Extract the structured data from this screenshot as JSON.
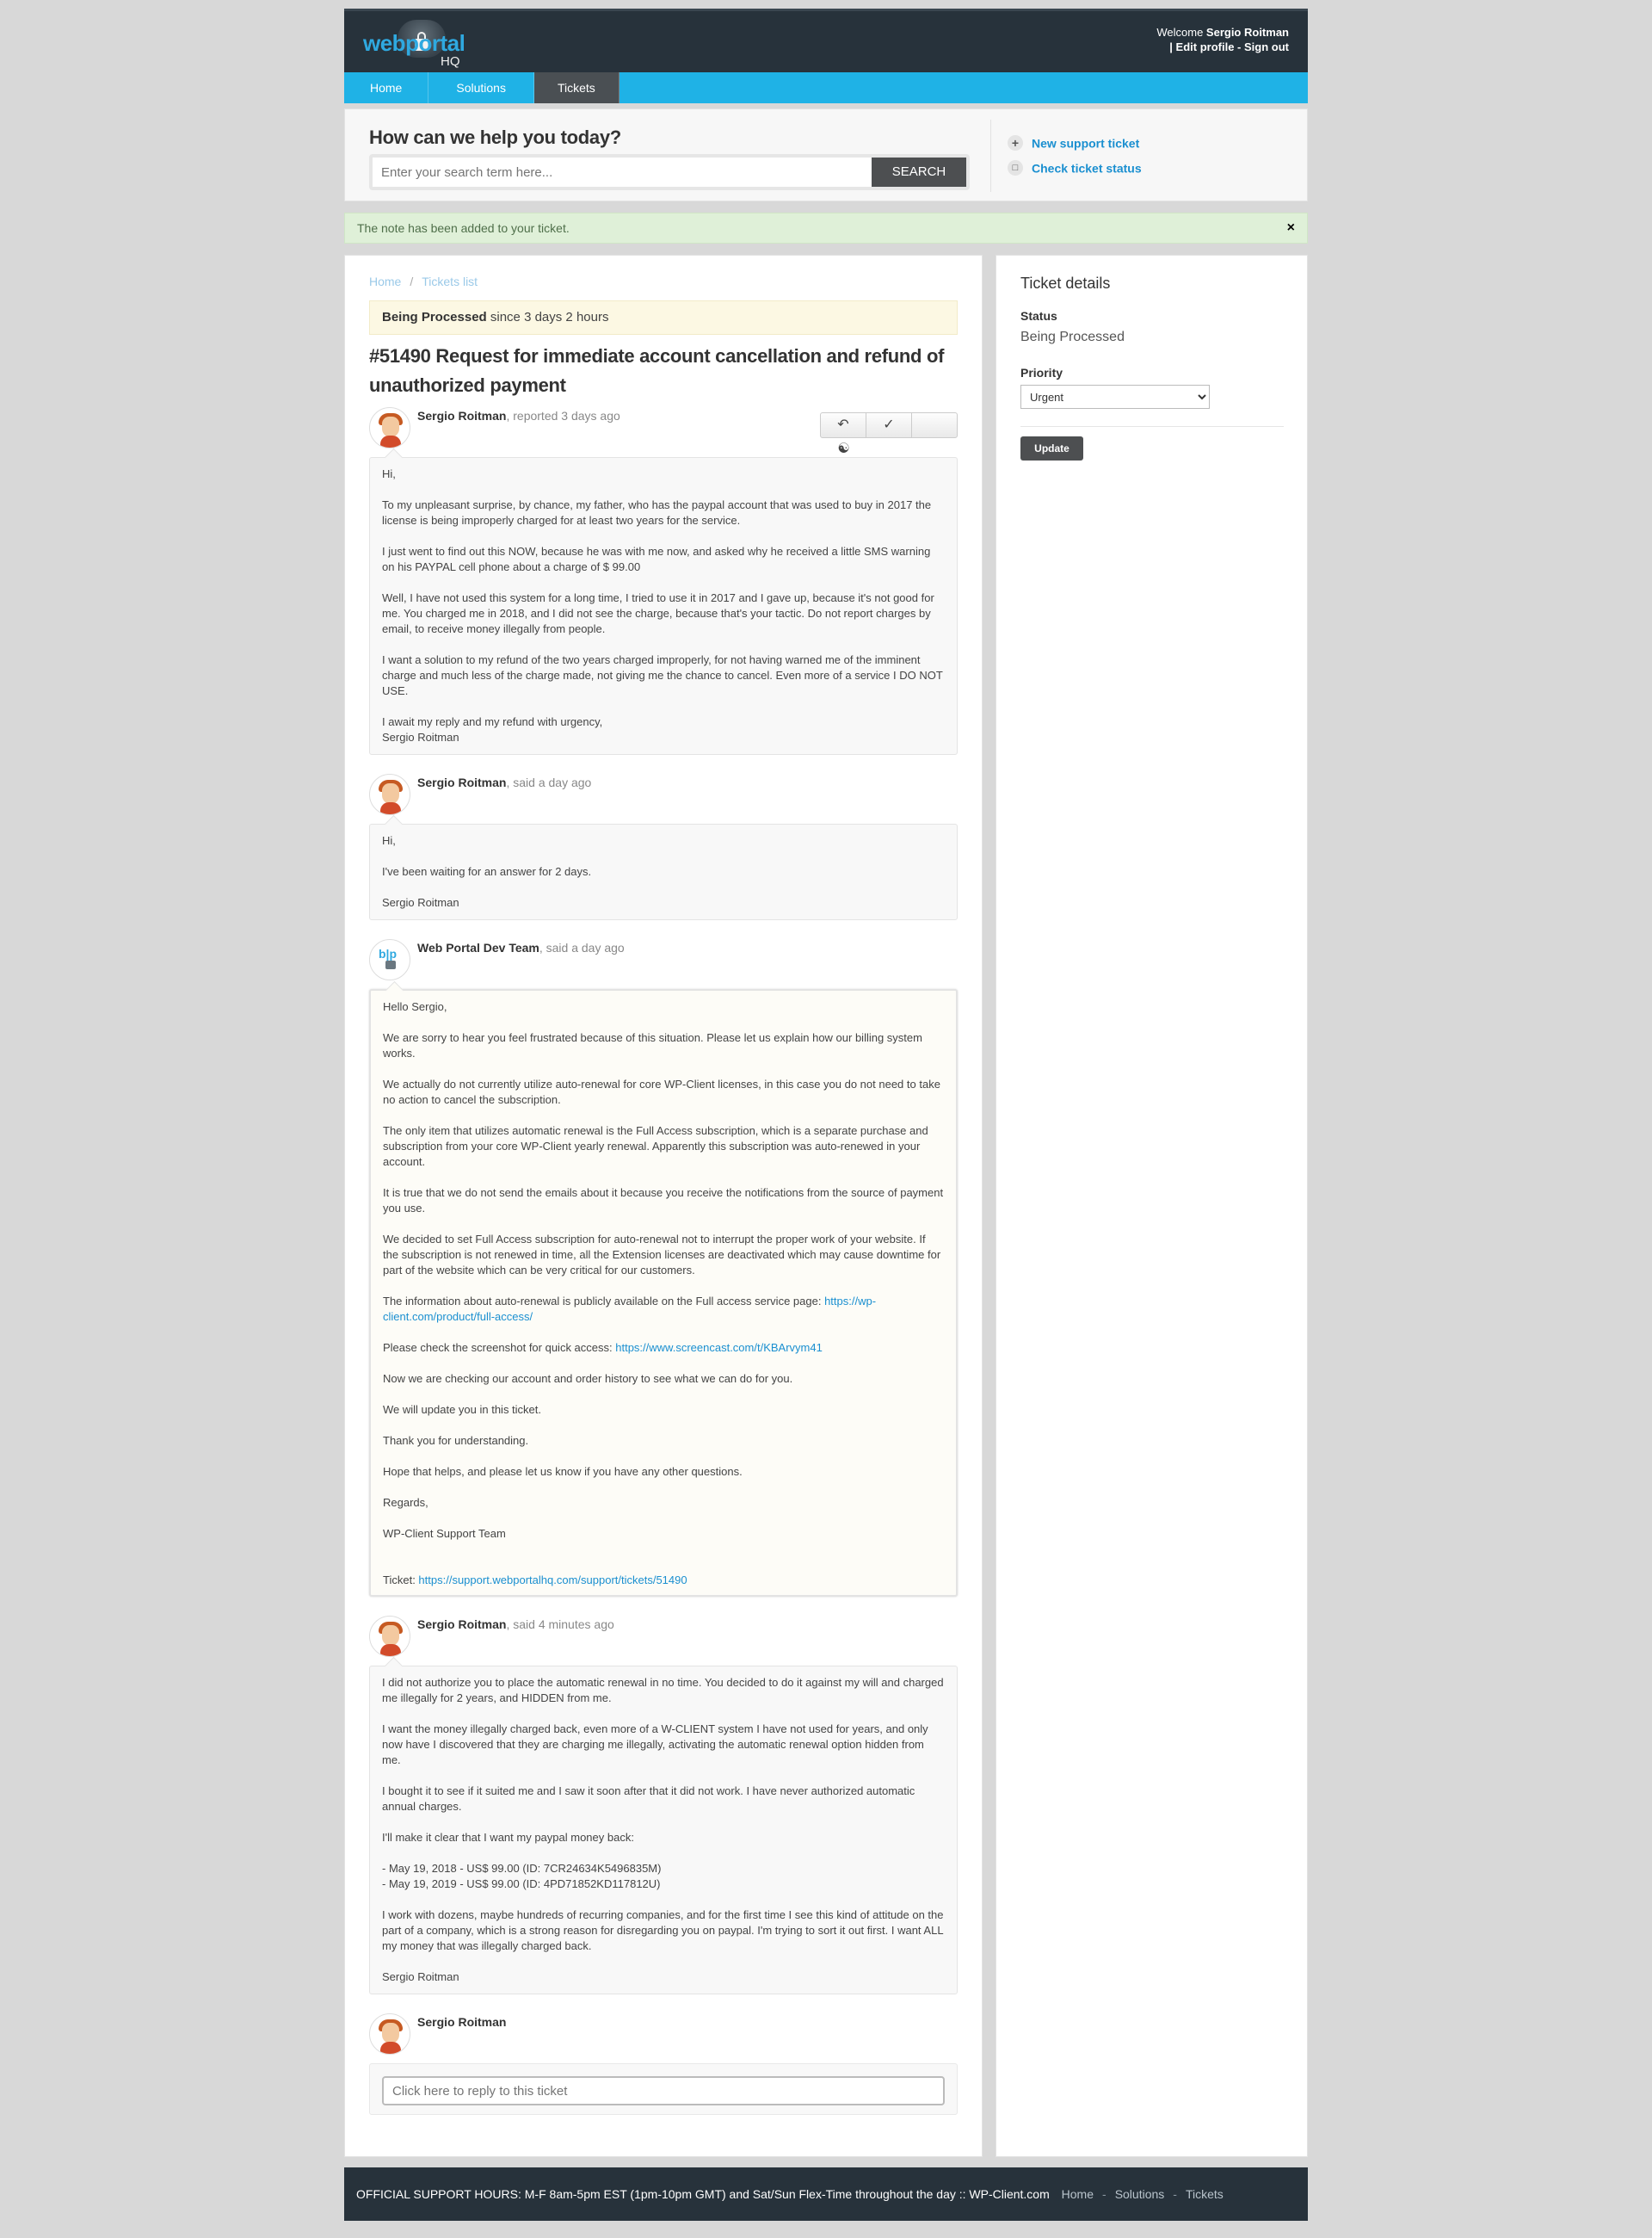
{
  "header": {
    "logo_web": "webportal",
    "logo_hq": "HQ",
    "welcome_prefix": "Welcome ",
    "user_name": "Sergio Roitman",
    "edit_profile": "Edit profile",
    "sign_out": "Sign out",
    "link_sep_lead": "| ",
    "link_sep_mid": " - "
  },
  "nav": {
    "tabs": [
      "Home",
      "Solutions",
      "Tickets"
    ]
  },
  "search": {
    "title": "How can we help you today?",
    "placeholder": "Enter your search term here...",
    "button": "SEARCH",
    "new_ticket": "New support ticket",
    "check_status": "Check ticket status"
  },
  "alert": {
    "text": "The note has been added to your ticket.",
    "close": "×"
  },
  "breadcrumb": {
    "home": "Home",
    "sep": "/",
    "list": "Tickets list"
  },
  "ticket": {
    "status_bold": "Being Processed",
    "status_since": " since 3 days 2 hours",
    "title": "#51490 Request for immediate account cancellation and refund of unauthorized payment"
  },
  "conversation": [
    {
      "author": "Sergio Roitman",
      "meta": ", reported 3 days ago",
      "paragraphs": [
        "Hi,",
        "To my unpleasant surprise, by chance, my father, who has the paypal account that was used to buy in 2017 the license is being improperly charged for at least two years for the service.",
        "I just went to find out this NOW, because he was with me now, and asked why he received a little SMS warning on his PAYPAL cell phone about a charge of $ 99.00",
        "Well, I have not used this system for a long time, I tried to use it in 2017 and I gave up, because it's not good for me. You charged me in 2018, and I did not see the charge, because that's your tactic. Do not report charges by email, to receive money illegally from people.",
        "I want a solution to my refund of the two years charged improperly, for not having warned me of the imminent charge and much less of the charge made, not giving me the chance to cancel. Even more of a service I DO NOT USE.",
        "I await my reply and my refund with urgency,\nSergio Roitman"
      ]
    },
    {
      "author": "Sergio Roitman",
      "meta": ", said a day ago",
      "paragraphs": [
        "Hi,",
        "I've been waiting for an answer for 2 days.",
        "Sergio Roitman"
      ]
    },
    {
      "author": "Web Portal Dev Team",
      "meta": ", said a day ago",
      "paragraphs": [
        "Hello Sergio,",
        "We are sorry to hear you feel frustrated because of this situation. Please let us explain how our billing system works.",
        "We actually do not currently utilize auto-renewal for core WP-Client licenses, in this case you do not need to take no action to cancel the subscription.",
        "The only item that utilizes automatic renewal is the Full Access subscription, which is a separate purchase and subscription from your core WP-Client yearly renewal. Apparently this subscription was auto-renewed in your account.",
        "It is true that we do not send the emails about it because you receive the notifications from the source of payment you use.",
        "We decided to set Full Access subscription for auto-renewal not to interrupt the proper work of your website. If the subscription is not renewed in time, all the Extension licenses are deactivated which may cause downtime for part of the website which can be very critical for our customers."
      ],
      "info_prefix": "The information about auto-renewal is publicly available on the Full access service page: ",
      "info_link": "https://wp-client.com/product/full-access/",
      "shot_prefix": "Please check the screenshot for quick access: ",
      "shot_link": "https://www.screencast.com/t/KBArvym41",
      "paragraphs_after": [
        "Now we are checking our account and order history to see what we can do for you.",
        "We will update you in this ticket.",
        "Thank you for understanding.",
        "Hope that helps, and please let us know if you have any other questions.",
        "Regards,",
        "WP-Client Support Team"
      ],
      "ticket_prefix": "Ticket: ",
      "ticket_link": "https://support.webportalhq.com/support/tickets/51490"
    },
    {
      "author": "Sergio Roitman",
      "meta": ", said 4 minutes ago",
      "paragraphs": [
        "I did not authorize you to place the automatic renewal in no time. You decided to do it against my will and charged me illegally for 2 years, and HIDDEN from me.",
        "I want the money illegally charged back, even more of a W-CLIENT system I have not used for years, and only now have I discovered that they are charging me illegally, activating the automatic renewal option hidden from me.",
        "I bought it to see if it suited me and I saw it soon after that it did not work. I have never authorized automatic annual charges.",
        "I'll make it clear that I want my paypal money back:",
        "- May 19, 2018 - US$ 99.00 (ID: 7CR24634K5496835M)\n- May 19, 2019 - US$ 99.00 (ID: 4PD71852KD117812U)",
        "I work with dozens, maybe hundreds of recurring companies, and for the first time I see this kind of attitude on the part of a company, which is a strong reason for disregarding you on paypal. I'm trying to sort it out first. I want ALL my money that was illegally charged back.",
        "Sergio Roitman"
      ]
    }
  ],
  "reply": {
    "author": "Sergio Roitman",
    "placeholder": "Click here to reply to this ticket"
  },
  "sidebar": {
    "title": "Ticket details",
    "status_label": "Status",
    "status_value": "Being Processed",
    "priority_label": "Priority",
    "priority_value": "Urgent",
    "update": "Update"
  },
  "footer": {
    "hours": "OFFICIAL SUPPORT HOURS: M-F 8am-5pm EST (1pm-10pm GMT) and Sat/Sun Flex-Time throughout the day :: WP-Client.com",
    "links": [
      "Home",
      "Solutions",
      "Tickets"
    ],
    "sep": "-"
  },
  "colors": {
    "nav": "#1fb2e6",
    "header": "#27323b",
    "link": "#1a8fd0",
    "alert_bg": "#dff0d8",
    "status_bg": "#fcf8e3"
  }
}
